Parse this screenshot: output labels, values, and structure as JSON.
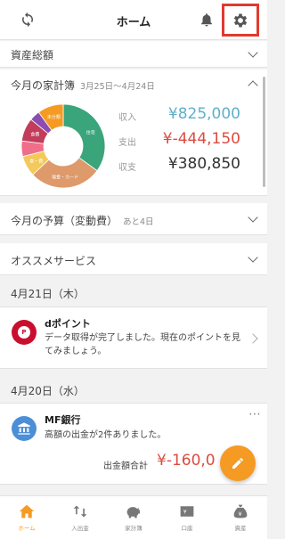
{
  "header": {
    "title": "ホーム"
  },
  "sections": {
    "assets_overview": "資産総額",
    "monthly_budget_book": {
      "label": "今月の家計簿",
      "period": "3月25日〜4月24日"
    },
    "monthly_budget": {
      "label": "今月の予算（変動費）",
      "remaining": "あと4日"
    },
    "recommended": "オススメサービス"
  },
  "summary": {
    "income_label": "収入",
    "income_value": "¥825,000",
    "expense_label": "支出",
    "expense_value": "¥-444,150",
    "balance_label": "収支",
    "balance_value": "¥380,850"
  },
  "donut": {
    "segments": [
      {
        "label": "住宅",
        "value": 35,
        "color": "#3aa57a"
      },
      {
        "label": "現金・カード",
        "value": 28,
        "color": "#de9a6a"
      },
      {
        "label": "食・費",
        "value": 8,
        "color": "#f3c95a"
      },
      {
        "label": "",
        "value": 6,
        "color": "#f06e8a"
      },
      {
        "label": "食費",
        "value": 9,
        "color": "#c23d5a"
      },
      {
        "label": "",
        "value": 4,
        "color": "#8c4db1"
      },
      {
        "label": "未分類",
        "value": 10,
        "color": "#f59a23"
      }
    ]
  },
  "feed": {
    "date1": "4月21日（木）",
    "card1": {
      "title": "dポイント",
      "message": "データ取得が完了しました。現在のポイントを見てみましょう。",
      "badge": "P"
    },
    "date2": "4月20日（水）",
    "card2": {
      "title": "MF銀行",
      "message": "高額の出金が2件ありました。",
      "total_label": "出金額合計",
      "total_value": "¥-160,0"
    }
  },
  "tabs": [
    {
      "label": "ホーム",
      "active": true
    },
    {
      "label": "入出金",
      "active": false
    },
    {
      "label": "家計簿",
      "active": false
    },
    {
      "label": "口座",
      "active": false
    },
    {
      "label": "資産",
      "active": false
    }
  ],
  "colors": {
    "accent": "#f59a23",
    "income": "#5fb0c9",
    "expense": "#dd4b3f",
    "highlight": "#e03a2e"
  }
}
